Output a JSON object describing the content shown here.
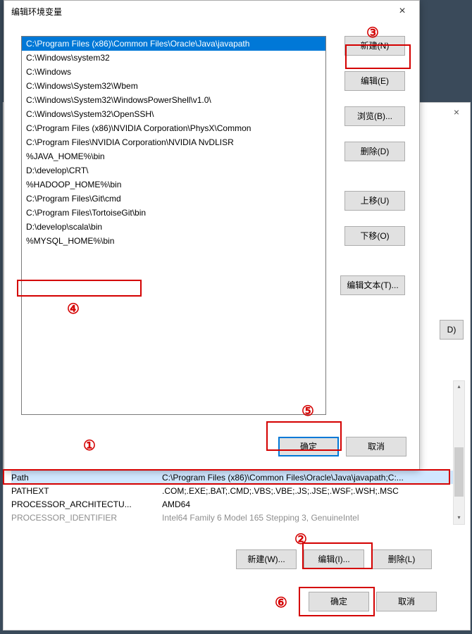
{
  "bgClose": "×",
  "dialog": {
    "title": "编辑环境变量",
    "close": "×",
    "list": [
      "C:\\Program Files (x86)\\Common Files\\Oracle\\Java\\javapath",
      "C:\\Windows\\system32",
      "C:\\Windows",
      "C:\\Windows\\System32\\Wbem",
      "C:\\Windows\\System32\\WindowsPowerShell\\v1.0\\",
      "C:\\Windows\\System32\\OpenSSH\\",
      "C:\\Program Files (x86)\\NVIDIA Corporation\\PhysX\\Common",
      "C:\\Program Files\\NVIDIA Corporation\\NVIDIA NvDLISR",
      "%JAVA_HOME%\\bin",
      "D:\\develop\\CRT\\",
      "%HADOOP_HOME%\\bin",
      "C:\\Program Files\\Git\\cmd",
      "C:\\Program Files\\TortoiseGit\\bin",
      "D:\\develop\\scala\\bin",
      "%MYSQL_HOME%\\bin"
    ],
    "buttons": {
      "new": "新建(N)",
      "edit": "编辑(E)",
      "browse": "浏览(B)...",
      "delete": "删除(D)",
      "moveUp": "上移(U)",
      "moveDown": "下移(O)",
      "editText": "编辑文本(T)...",
      "ok": "确定",
      "cancel": "取消"
    }
  },
  "sysvars": [
    {
      "name": "Path",
      "value": "C:\\Program Files (x86)\\Common Files\\Oracle\\Java\\javapath;C:..."
    },
    {
      "name": "PATHEXT",
      "value": ".COM;.EXE;.BAT;.CMD;.VBS;.VBE;.JS;.JSE;.WSF;.WSH;.MSC"
    },
    {
      "name": "PROCESSOR_ARCHITECTU...",
      "value": "AMD64"
    },
    {
      "name": "PROCESSOR_IDENTIFIER",
      "value": "Intel64 Family 6 Model 165 Stepping 3, GenuineIntel"
    }
  ],
  "lowerButtons": {
    "new": "新建(W)...",
    "edit": "编辑(I)...",
    "delete": "删除(L)"
  },
  "finalButtons": {
    "ok": "确定",
    "cancel": "取消"
  },
  "dBtn": "D)",
  "scroll": {
    "up": "▴",
    "down": "▾"
  },
  "annotations": {
    "a1": "①",
    "a2": "②",
    "a3": "③",
    "a4": "④",
    "a5": "⑤",
    "a6": "⑥"
  }
}
